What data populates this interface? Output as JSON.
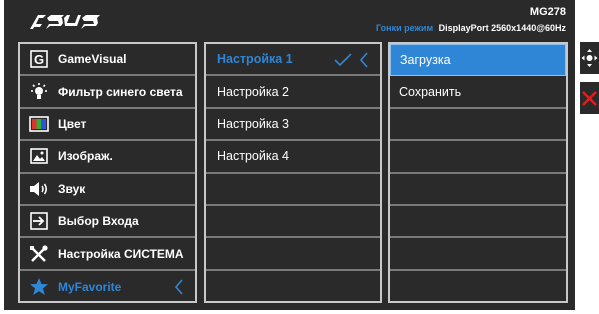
{
  "header": {
    "model": "MG278",
    "mode_label": "Гонки режим",
    "connection_info": "DisplayPort 2560x1440@60Hz"
  },
  "menu": {
    "items": [
      {
        "label": "GameVisual",
        "icon": "gamevisual-icon"
      },
      {
        "label": "Фильтр синего света",
        "icon": "blue-light-icon"
      },
      {
        "label": "Цвет",
        "icon": "color-icon"
      },
      {
        "label": "Изображ.",
        "icon": "image-icon"
      },
      {
        "label": "Звук",
        "icon": "speaker-icon"
      },
      {
        "label": "Выбор Входа",
        "icon": "input-select-icon"
      },
      {
        "label": "Настройка СИСТЕМА",
        "icon": "tools-icon"
      },
      {
        "label": "MyFavorite",
        "icon": "star-icon"
      }
    ],
    "selected_index": 7
  },
  "submenu": {
    "items": [
      "Настройка 1",
      "Настройка 2",
      "Настройка 3",
      "Настройка 4",
      "",
      "",
      "",
      ""
    ],
    "selected_index": 0
  },
  "actions": {
    "items": [
      "Загрузка",
      "Сохранить",
      "",
      "",
      "",
      "",
      "",
      ""
    ],
    "highlight_index": 0
  },
  "side_buttons": [
    {
      "icon": "navigate-joystick-icon"
    },
    {
      "icon": "close-icon"
    }
  ],
  "colors": {
    "accent": "#2f86d6",
    "background": "#2a2a2a",
    "close": "#e02020"
  }
}
